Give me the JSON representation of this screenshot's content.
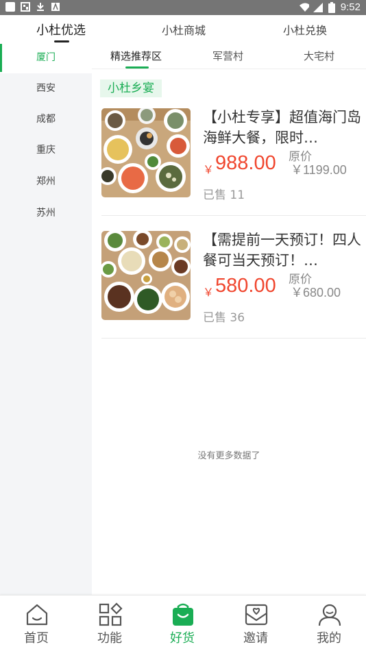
{
  "status_bar": {
    "time": "9:52",
    "left_icons": [
      "square-icon",
      "gallery-icon",
      "download-icon",
      "font-icon"
    ],
    "right_icons": [
      "wifi-icon",
      "signal-icon",
      "battery-icon"
    ]
  },
  "top_tabs": [
    {
      "label": "小杜优选",
      "active": true
    },
    {
      "label": "小杜商城",
      "active": false
    },
    {
      "label": "小杜兑换",
      "active": false
    }
  ],
  "cities": [
    {
      "label": "厦门",
      "active": true
    },
    {
      "label": "西安",
      "active": false
    },
    {
      "label": "成都",
      "active": false
    },
    {
      "label": "重庆",
      "active": false
    },
    {
      "label": "郑州",
      "active": false
    },
    {
      "label": "苏州",
      "active": false
    }
  ],
  "sub_tabs": [
    {
      "label": "精选推荐区",
      "active": true
    },
    {
      "label": "军营村",
      "active": false
    },
    {
      "label": "大宅村",
      "active": false
    }
  ],
  "section_title": "小杜乡宴",
  "products": [
    {
      "title": "【小杜专享】超值海门岛海鲜大餐，限时…",
      "currency": "￥",
      "price": "988.00",
      "original_label": "原价",
      "original_price": "￥1199.00",
      "sold": "已售 11"
    },
    {
      "title": "【需提前一天预订！四人餐可当天预订！…",
      "currency": "￥",
      "price": "580.00",
      "original_label": "原价",
      "original_price": "￥680.00",
      "sold": "已售 36"
    }
  ],
  "no_more_text": "没有更多数据了",
  "bottom_nav": [
    {
      "label": "首页",
      "icon": "home-icon",
      "active": false
    },
    {
      "label": "功能",
      "icon": "grid-icon",
      "active": false
    },
    {
      "label": "好货",
      "icon": "shopping-bag-icon",
      "active": true
    },
    {
      "label": "邀请",
      "icon": "invite-envelope-icon",
      "active": false
    },
    {
      "label": "我的",
      "icon": "user-icon",
      "active": false
    }
  ],
  "colors": {
    "accent": "#1aad54",
    "price": "#f0462e",
    "status_bar": "#757575",
    "sidebar_bg": "#f4f5f7"
  }
}
